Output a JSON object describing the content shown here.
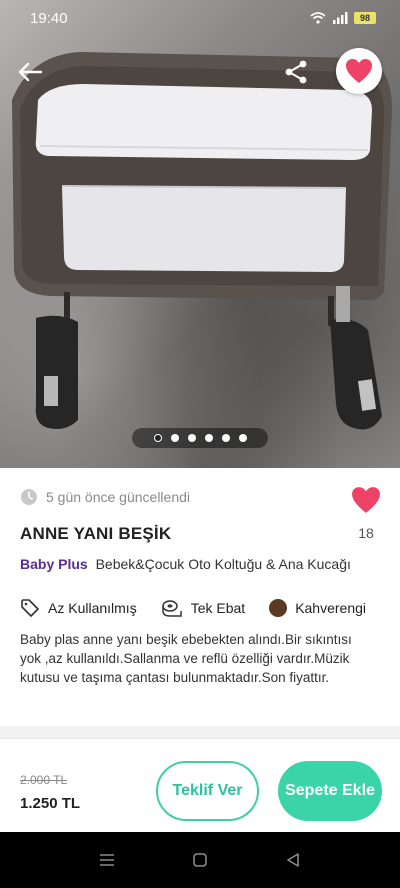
{
  "status_bar": {
    "time": "19:40",
    "battery": "98"
  },
  "photo": {
    "dots_total": 6,
    "active_dot": 1
  },
  "listing": {
    "updated": "5 gün önce güncellendi",
    "like_count": "18",
    "title": "ANNE YANI BEŞİK",
    "brand": "Baby Plus",
    "category": "Bebek&Çocuk Oto Koltuğu & Ana Kucağı",
    "attributes": {
      "condition": "Az Kullanılmış",
      "size": "Tek Ebat",
      "color": "Kahverengi"
    },
    "description": "Baby plas anne yanı beşik ebebekten alındı.Bir sıkıntısı yok ,az kullanıldı.Sallanma ve reflü özelliği vardır.Müzik kutusu ve taşıma çantası bulunmaktadır.Son fiyattır."
  },
  "pricing": {
    "old_price": "2.000 TL",
    "price": "1.250 TL"
  },
  "actions": {
    "offer_label": "Teklif Ver",
    "cart_label": "Sepete Ekle"
  },
  "colors": {
    "brand_purple": "#5b2d8f",
    "accent_green": "#3ad4a8",
    "heart_pink": "#ee4266",
    "swatch_brown": "#5a3a22"
  },
  "icons": {
    "back": "arrow-left-icon",
    "share": "share-icon",
    "favorite": "heart-icon",
    "clock": "clock-icon",
    "tag": "tag-icon",
    "measure": "tape-measure-icon"
  }
}
